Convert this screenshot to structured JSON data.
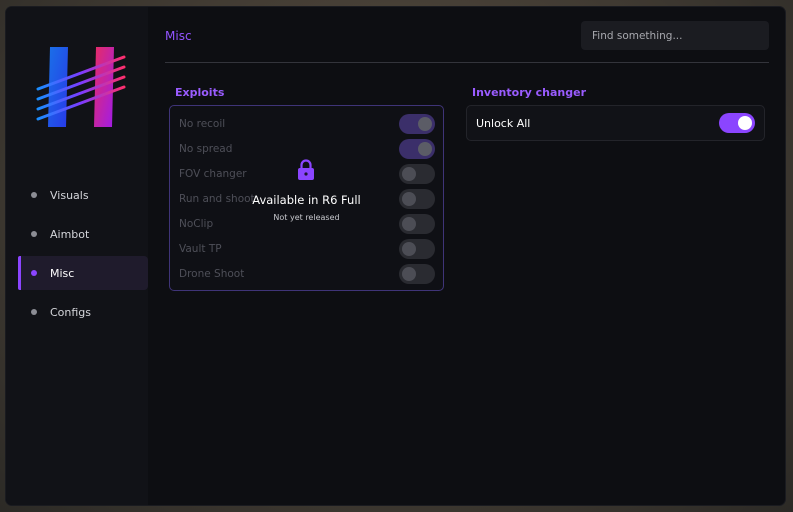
{
  "page": {
    "title": "Misc"
  },
  "search": {
    "placeholder": "Find something..."
  },
  "sidebar": {
    "items": [
      {
        "label": "Visuals",
        "active": false
      },
      {
        "label": "Aimbot",
        "active": false
      },
      {
        "label": "Misc",
        "active": true
      },
      {
        "label": "Configs",
        "active": false
      }
    ]
  },
  "exploits": {
    "title": "Exploits",
    "features": [
      {
        "label": "No recoil",
        "enabled": true
      },
      {
        "label": "No spread",
        "enabled": true
      },
      {
        "label": "FOV changer",
        "enabled": false
      },
      {
        "label": "Run and shoot",
        "enabled": false
      },
      {
        "label": "NoClip",
        "enabled": false
      },
      {
        "label": "Vault TP",
        "enabled": false
      },
      {
        "label": "Drone Shoot",
        "enabled": false
      }
    ],
    "lock": {
      "title": "Available in R6 Full",
      "subtitle": "Not yet released",
      "icon": "lock-icon"
    }
  },
  "inventory": {
    "title": "Inventory changer",
    "unlock_all_label": "Unlock All",
    "unlock_all_enabled": true
  },
  "colors": {
    "accent": "#8b45ff",
    "background": "#0d0e12",
    "sidebar": "#111217"
  }
}
